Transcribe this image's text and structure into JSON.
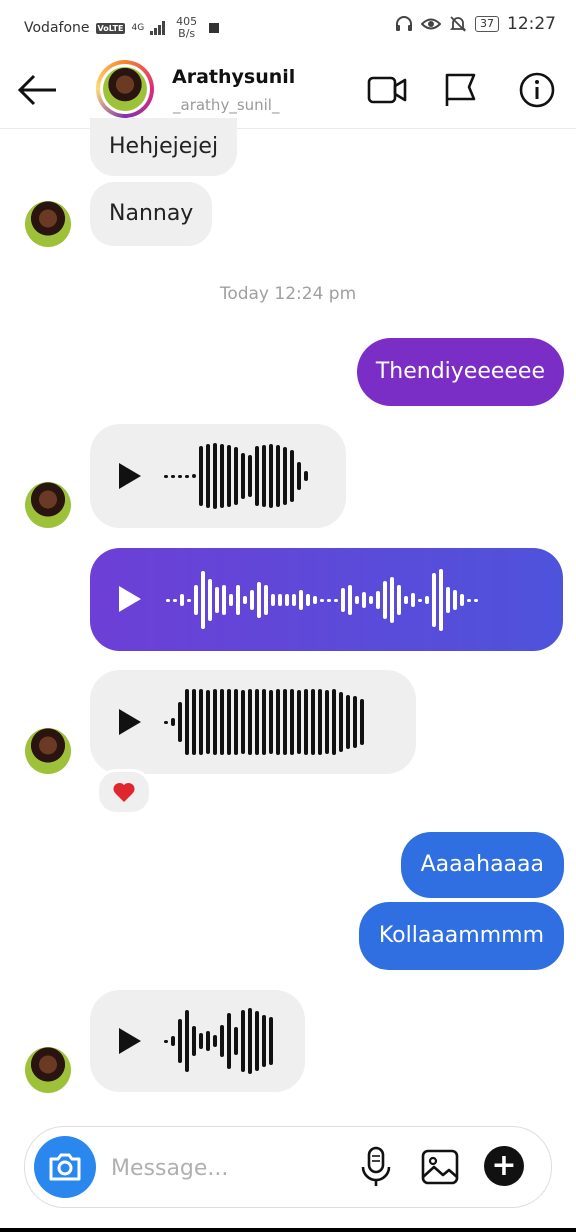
{
  "status_bar": {
    "carrier": "Vodafone",
    "volte": "VoLTE",
    "network_type": "4G",
    "speed_value": "405",
    "speed_unit": "B/s",
    "battery": "37",
    "time": "12:27"
  },
  "header": {
    "name": "Arathysunil",
    "username": "_arathy_sunil_"
  },
  "messages": [
    {
      "sender": "them",
      "text": "Hehjejejej"
    },
    {
      "sender": "them",
      "text": "Nannay"
    },
    {
      "type": "timestamp",
      "text": "Today 12:24 pm"
    },
    {
      "sender": "me",
      "text": "Thendiyeeeeee",
      "color": "#7b2ec6"
    },
    {
      "sender": "them",
      "type": "voice"
    },
    {
      "sender": "me",
      "type": "voice"
    },
    {
      "sender": "them",
      "type": "voice",
      "reaction": "heart-icon"
    },
    {
      "sender": "me",
      "text": "Aaaahaaaa",
      "color": "#2f6fe2"
    },
    {
      "sender": "me",
      "text": "Kollaaammmm",
      "color": "#2f6fe2"
    },
    {
      "sender": "them",
      "type": "voice"
    }
  ],
  "composer": {
    "placeholder": "Message..."
  },
  "colors": {
    "accent_blue": "#2a87ee",
    "outgoing_purple": "#7b2ec6",
    "outgoing_blue": "#2f6fe2",
    "incoming_gray": "#efefef"
  },
  "icons": [
    "back-arrow-icon",
    "video-call-icon",
    "flag-icon",
    "info-icon",
    "camera-icon",
    "microphone-icon",
    "gallery-icon",
    "plus-icon",
    "play-icon",
    "heart-icon"
  ]
}
